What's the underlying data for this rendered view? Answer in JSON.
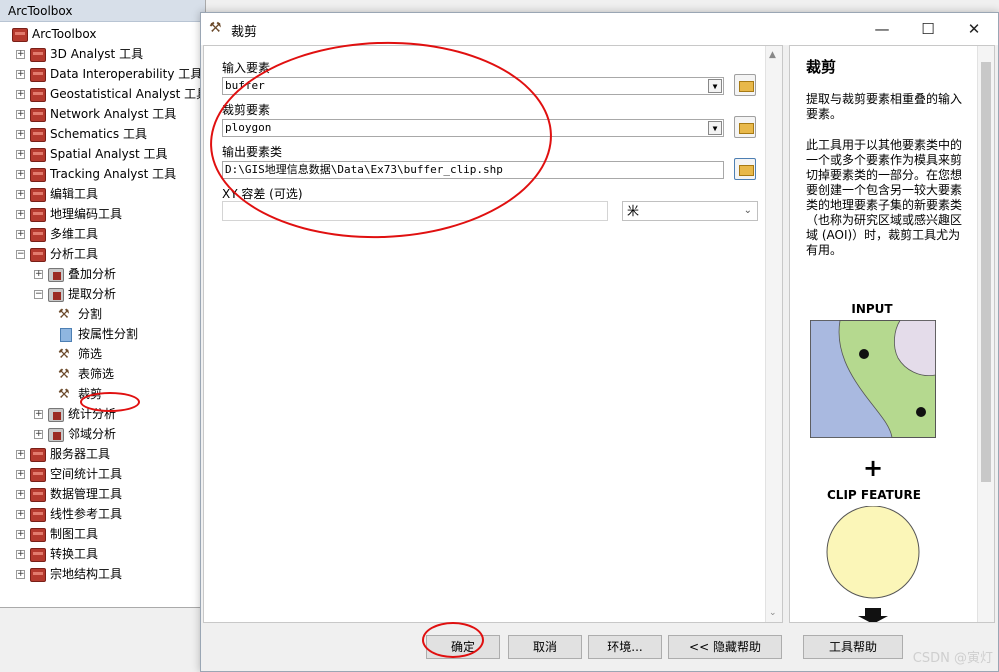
{
  "toolbox": {
    "title": "ArcToolbox",
    "root": "ArcToolbox",
    "items": [
      {
        "label": "3D Analyst 工具",
        "level": 1,
        "expander": "+",
        "icon": "toolbox"
      },
      {
        "label": "Data Interoperability 工具",
        "level": 1,
        "expander": "+",
        "icon": "toolbox"
      },
      {
        "label": "Geostatistical Analyst 工具",
        "level": 1,
        "expander": "+",
        "icon": "toolbox"
      },
      {
        "label": "Network Analyst 工具",
        "level": 1,
        "expander": "+",
        "icon": "toolbox"
      },
      {
        "label": "Schematics 工具",
        "level": 1,
        "expander": "+",
        "icon": "toolbox"
      },
      {
        "label": "Spatial Analyst 工具",
        "level": 1,
        "expander": "+",
        "icon": "toolbox"
      },
      {
        "label": "Tracking Analyst 工具",
        "level": 1,
        "expander": "+",
        "icon": "toolbox"
      },
      {
        "label": "编辑工具",
        "level": 1,
        "expander": "+",
        "icon": "toolbox"
      },
      {
        "label": "地理编码工具",
        "level": 1,
        "expander": "+",
        "icon": "toolbox"
      },
      {
        "label": "多维工具",
        "level": 1,
        "expander": "+",
        "icon": "toolbox"
      },
      {
        "label": "分析工具",
        "level": 1,
        "expander": "−",
        "icon": "toolbox"
      },
      {
        "label": "叠加分析",
        "level": 2,
        "expander": "+",
        "icon": "toolset"
      },
      {
        "label": "提取分析",
        "level": 2,
        "expander": "−",
        "icon": "toolset"
      },
      {
        "label": "分割",
        "level": 3,
        "expander": "",
        "icon": "hammer"
      },
      {
        "label": "按属性分割",
        "level": 3,
        "expander": "",
        "icon": "script"
      },
      {
        "label": "筛选",
        "level": 3,
        "expander": "",
        "icon": "hammer"
      },
      {
        "label": "表筛选",
        "level": 3,
        "expander": "",
        "icon": "hammer"
      },
      {
        "label": "裁剪",
        "level": 3,
        "expander": "",
        "icon": "hammer"
      },
      {
        "label": "统计分析",
        "level": 2,
        "expander": "+",
        "icon": "toolset"
      },
      {
        "label": "邻域分析",
        "level": 2,
        "expander": "+",
        "icon": "toolset"
      },
      {
        "label": "服务器工具",
        "level": 1,
        "expander": "+",
        "icon": "toolbox"
      },
      {
        "label": "空间统计工具",
        "level": 1,
        "expander": "+",
        "icon": "toolbox"
      },
      {
        "label": "数据管理工具",
        "level": 1,
        "expander": "+",
        "icon": "toolbox"
      },
      {
        "label": "线性参考工具",
        "level": 1,
        "expander": "+",
        "icon": "toolbox"
      },
      {
        "label": "制图工具",
        "level": 1,
        "expander": "+",
        "icon": "toolbox"
      },
      {
        "label": "转换工具",
        "level": 1,
        "expander": "+",
        "icon": "toolbox"
      },
      {
        "label": "宗地结构工具",
        "level": 1,
        "expander": "+",
        "icon": "toolbox"
      }
    ]
  },
  "dialog": {
    "title": "裁剪",
    "window_buttons": {
      "minimize": "—",
      "maximize": "☐",
      "close": "✕"
    },
    "fields": {
      "input_label": "输入要素",
      "input_value": "buffer",
      "clip_label": "裁剪要素",
      "clip_value": "ploygon",
      "output_label": "输出要素类",
      "output_value": "D:\\GIS地理信息数据\\Data\\Ex73\\buffer_clip.shp",
      "xy_label": "XY 容差 (可选)",
      "xy_value": "",
      "unit_value": "米"
    },
    "help": {
      "title": "裁剪",
      "p1": "提取与裁剪要素相重叠的输入要素。",
      "p2": "此工具用于以其他要素类中的一个或多个要素作为模具来剪切掉要素类的一部分。在您想要创建一个包含另一较大要素类的地理要素子集的新要素类（也称为研究区域或感兴趣区域 (AOI)）时，裁剪工具尤为有用。",
      "input_caption": "INPUT",
      "plus": "+",
      "clip_caption": "CLIP FEATURE"
    },
    "buttons": {
      "ok": "确定",
      "cancel": "取消",
      "env": "环境...",
      "hide_help": "<< 隐藏帮助",
      "tool_help": "工具帮助"
    }
  },
  "watermark": "CSDN @寅灯",
  "colors": {
    "annotation_red": "#e01010",
    "toolbox_red": "#b53a2e",
    "map_green": "#b5d98f",
    "map_blue": "#a9b9e0",
    "map_lilac": "#e4dcea",
    "clip_yellow": "#fbf6b8"
  }
}
